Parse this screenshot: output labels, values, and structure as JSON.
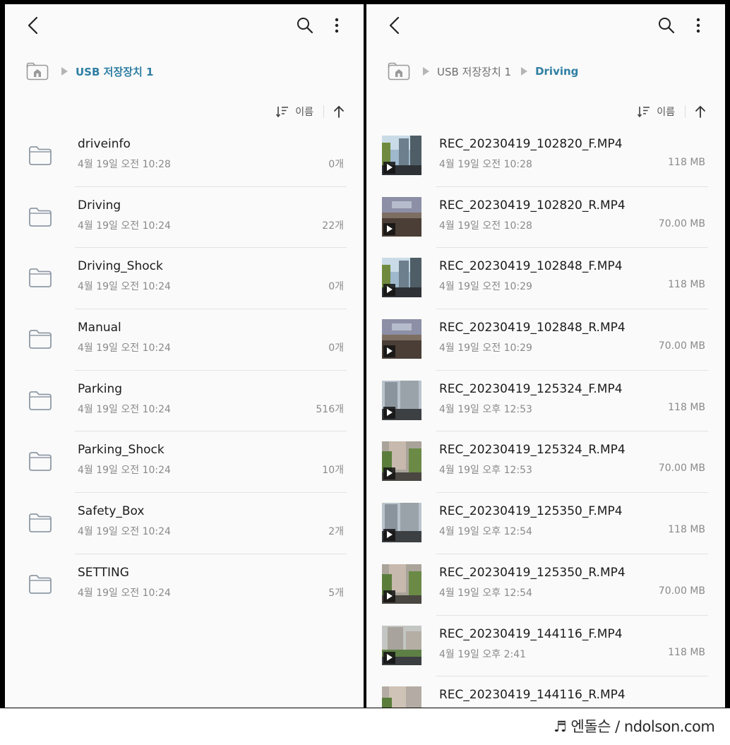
{
  "left_panel": {
    "breadcrumb": [
      "USB 저장장치 1"
    ],
    "sort_label": "이름",
    "items": [
      {
        "name": "driveinfo",
        "date": "4월 19일 오전 10:28",
        "count": "0개"
      },
      {
        "name": "Driving",
        "date": "4월 19일 오전 10:24",
        "count": "22개"
      },
      {
        "name": "Driving_Shock",
        "date": "4월 19일 오전 10:24",
        "count": "0개"
      },
      {
        "name": "Manual",
        "date": "4월 19일 오전 10:24",
        "count": "0개"
      },
      {
        "name": "Parking",
        "date": "4월 19일 오전 10:24",
        "count": "516개"
      },
      {
        "name": "Parking_Shock",
        "date": "4월 19일 오전 10:24",
        "count": "10개"
      },
      {
        "name": "Safety_Box",
        "date": "4월 19일 오전 10:24",
        "count": "2개"
      },
      {
        "name": "SETTING",
        "date": "4월 19일 오전 10:24",
        "count": "5개"
      }
    ]
  },
  "right_panel": {
    "breadcrumb": [
      "USB 저장장치 1",
      "Driving"
    ],
    "sort_label": "이름",
    "items": [
      {
        "name": "REC_20230419_102820_F.MP4",
        "date": "4월 19일 오전 10:28",
        "size": "118 MB",
        "thumb": "front"
      },
      {
        "name": "REC_20230419_102820_R.MP4",
        "date": "4월 19일 오전 10:28",
        "size": "70.00 MB",
        "thumb": "rear"
      },
      {
        "name": "REC_20230419_102848_F.MP4",
        "date": "4월 19일 오전 10:29",
        "size": "118 MB",
        "thumb": "front"
      },
      {
        "name": "REC_20230419_102848_R.MP4",
        "date": "4월 19일 오전 10:29",
        "size": "70.00 MB",
        "thumb": "rear"
      },
      {
        "name": "REC_20230419_125324_F.MP4",
        "date": "4월 19일 오후 12:53",
        "size": "118 MB",
        "thumb": "front2"
      },
      {
        "name": "REC_20230419_125324_R.MP4",
        "date": "4월 19일 오후 12:53",
        "size": "70.00 MB",
        "thumb": "rear2"
      },
      {
        "name": "REC_20230419_125350_F.MP4",
        "date": "4월 19일 오후 12:54",
        "size": "118 MB",
        "thumb": "front2"
      },
      {
        "name": "REC_20230419_125350_R.MP4",
        "date": "4월 19일 오후 12:54",
        "size": "70.00 MB",
        "thumb": "rear2"
      },
      {
        "name": "REC_20230419_144116_F.MP4",
        "date": "4월 19일 오후 2:41",
        "size": "118 MB",
        "thumb": "front3"
      },
      {
        "name": "REC_20230419_144116_R.MP4",
        "date": "",
        "size": "",
        "thumb": "rear3"
      }
    ]
  },
  "icons": {
    "back": "back-arrow-icon",
    "search": "search-icon",
    "more": "more-vert-icon",
    "home": "home-folder-icon",
    "sort": "sort-icon",
    "sort_dir": "arrow-up-icon",
    "folder": "folder-icon",
    "play": "play-icon"
  },
  "colors": {
    "accent": "#2f7fa3",
    "text": "#1c1c1c",
    "secondary": "#8a8a8a",
    "background": "#fafafa",
    "divider": "#e3e3e3"
  },
  "watermark": "♬ 엔돌슨 / ndolson.com"
}
